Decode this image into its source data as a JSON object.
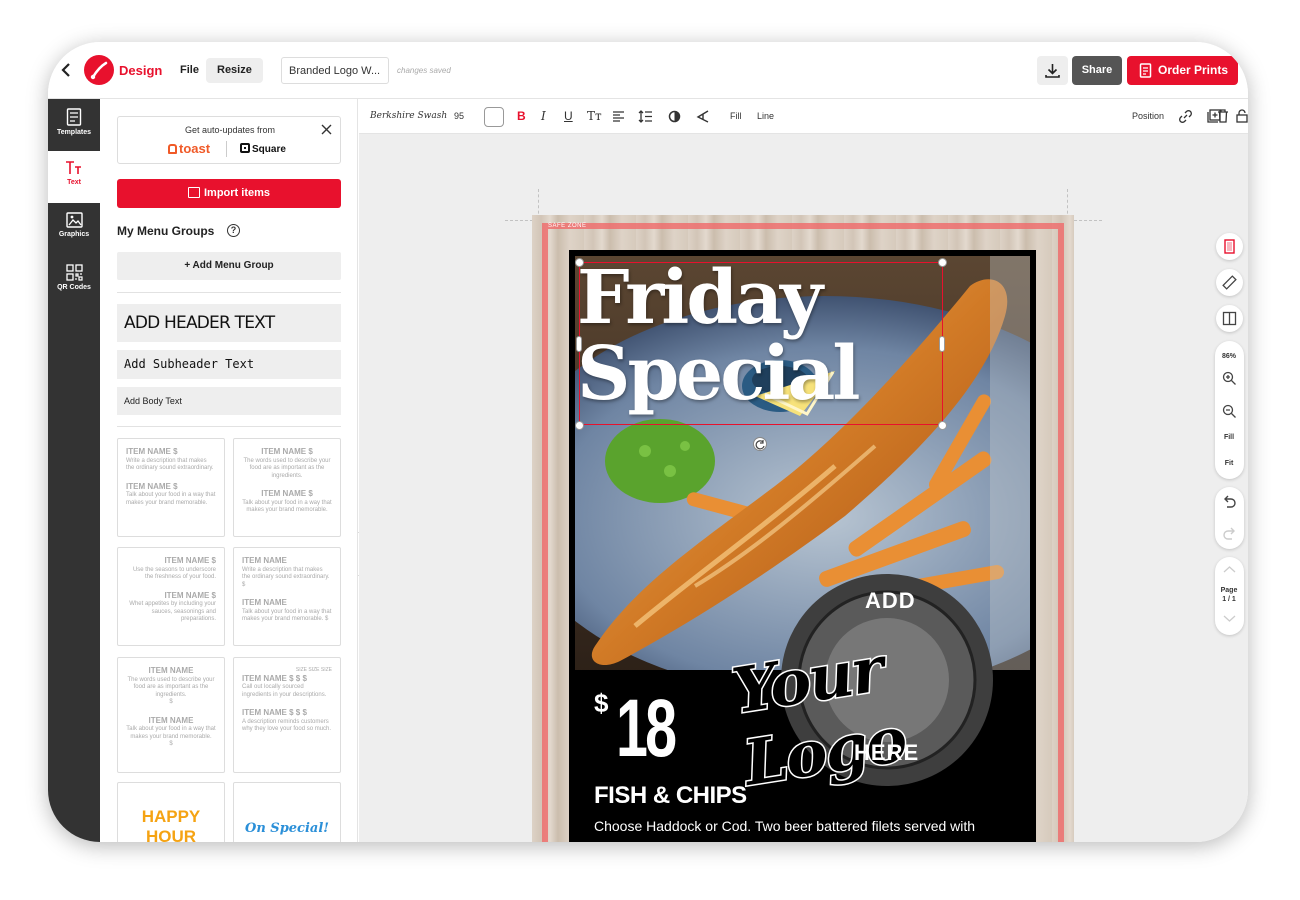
{
  "topbar": {
    "brand": "Design",
    "menu_file": "File",
    "menu_resize": "Resize",
    "doc_name": "Branded Logo W...",
    "save_status": "changes saved",
    "share_label": "Share",
    "order_label": "Order Prints"
  },
  "sidebar": {
    "items": [
      {
        "label": "Templates",
        "icon": "templates-icon"
      },
      {
        "label": "Text",
        "icon": "text-icon"
      },
      {
        "label": "Graphics",
        "icon": "graphics-icon"
      },
      {
        "label": "QR Codes",
        "icon": "qr-code-icon"
      }
    ],
    "active": "Text"
  },
  "panel": {
    "auto_updates_title": "Get auto-updates from",
    "toast_label": "toast",
    "square_label": "Square",
    "import_label": "Import items",
    "groups_title": "My Menu Groups",
    "add_group_label": "+ Add Menu Group",
    "header_text": "ADD HEADER TEXT",
    "subheader_text": "Add Subheader Text",
    "body_text": "Add Body Text",
    "templates": [
      {
        "l1": "ITEM NAME $",
        "d1": "Write a description that makes the ordinary sound extraordinary.",
        "l2": "ITEM NAME $",
        "d2": "Talk about your food in a way that makes your brand memorable."
      },
      {
        "l1": "ITEM NAME $",
        "d1": "The words used to describe your food are as important as the ingredients.",
        "l2": "ITEM NAME $",
        "d2": "Talk about your food in a way that makes your brand memorable."
      },
      {
        "l1": "ITEM NAME $",
        "d1": "Use the seasons to underscore the freshness of your food.",
        "l2": "ITEM NAME $",
        "d2": "Whet appetites by including your sauces, seasonings and preparations."
      },
      {
        "l1": "ITEM NAME",
        "d1": "Write a description that makes the ordinary sound extraordinary. $",
        "l2": "ITEM NAME",
        "d2": "Talk about your food in a way that makes your brand memorable. $"
      },
      {
        "l1": "ITEM NAME",
        "d1": "The words used to describe your food are as important as the ingredients.",
        "p1": "$",
        "l2": "ITEM NAME",
        "d2": "Talk about your food in a way that makes your brand memorable.",
        "p2": "$"
      },
      {
        "size_header": "SIZE  SIZE  SIZE",
        "l1": "ITEM NAME  $  $  $",
        "d1": "Call out locally sourced ingredients in your descriptions.",
        "l2": "ITEM NAME  $  $  $",
        "d2": "A description reminds customers why they love your food so much."
      }
    ],
    "happy_hour": "HAPPY HOUR",
    "on_special": "On Special!"
  },
  "toolbar": {
    "font": "Berkshire Swash",
    "size": "95",
    "bold": "B",
    "italic": "I",
    "underline": "U",
    "case": "Tт",
    "fill": "Fill",
    "line": "Line",
    "position": "Position"
  },
  "poster": {
    "safe_zone": "SAFE ZONE",
    "headline_1": "Friday",
    "headline_2": "Special",
    "dollar": "$",
    "price": "18",
    "dish": "FISH & CHIPS",
    "description": "Choose Haddock or Cod. Two beer battered filets served with",
    "logo_add": "ADD",
    "logo_your": "Your Logo",
    "logo_here": "HERE"
  },
  "rail": {
    "zoom": "86%",
    "fill": "Fill",
    "fit": "Fit",
    "page_label": "Page",
    "page_value": "1 / 1"
  },
  "colors": {
    "accent": "#e8112d",
    "sidebar": "#333333",
    "safe_zone": "#f06a6a"
  }
}
